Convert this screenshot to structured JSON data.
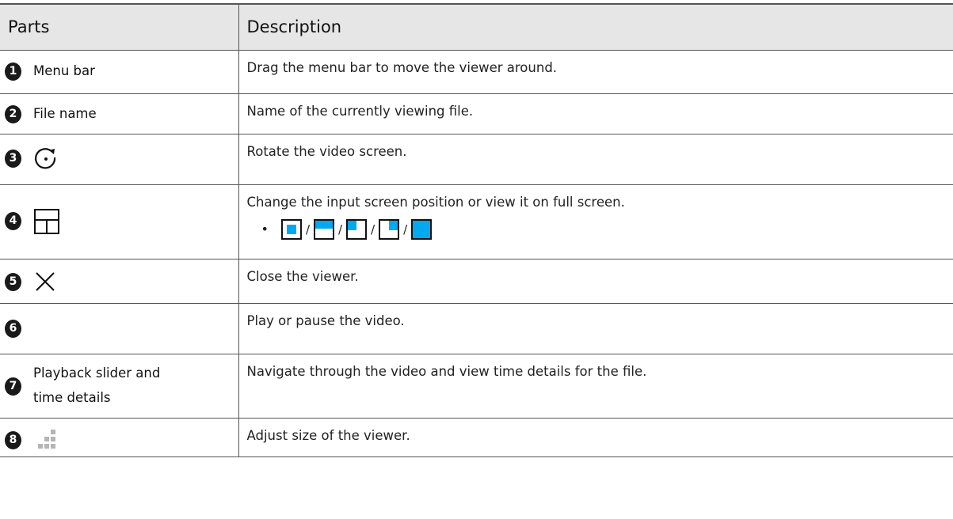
{
  "table": {
    "headers": {
      "parts": "Parts",
      "description": "Description"
    },
    "rows": [
      {
        "num": "1",
        "part": "Menu bar",
        "description": "Drag the menu bar to move the viewer around."
      },
      {
        "num": "2",
        "part": "File name",
        "description": "Name of the currently viewing file."
      },
      {
        "num": "3",
        "part_icon": "rotate-icon",
        "description": "Rotate the video screen."
      },
      {
        "num": "4",
        "part_icon": "layout-icon",
        "description": "Change the input screen position or view it on full screen.",
        "bullet": "•",
        "separator": "/"
      },
      {
        "num": "5",
        "part_icon": "close-icon",
        "description": "Close the viewer."
      },
      {
        "num": "6",
        "part_icon": "play-icon",
        "description": "Play or pause the video."
      },
      {
        "num": "7",
        "part_line1": "Playback slider and",
        "part_line2": "time details",
        "description": "Navigate through the video and view time details for the file."
      },
      {
        "num": "8",
        "part_icon": "resize-grip-icon",
        "description": "Adjust size of the viewer."
      }
    ]
  },
  "colors": {
    "accent": "#00a9f0",
    "header_bg": "#e6e6e6",
    "badge": "#1a1a1a"
  }
}
